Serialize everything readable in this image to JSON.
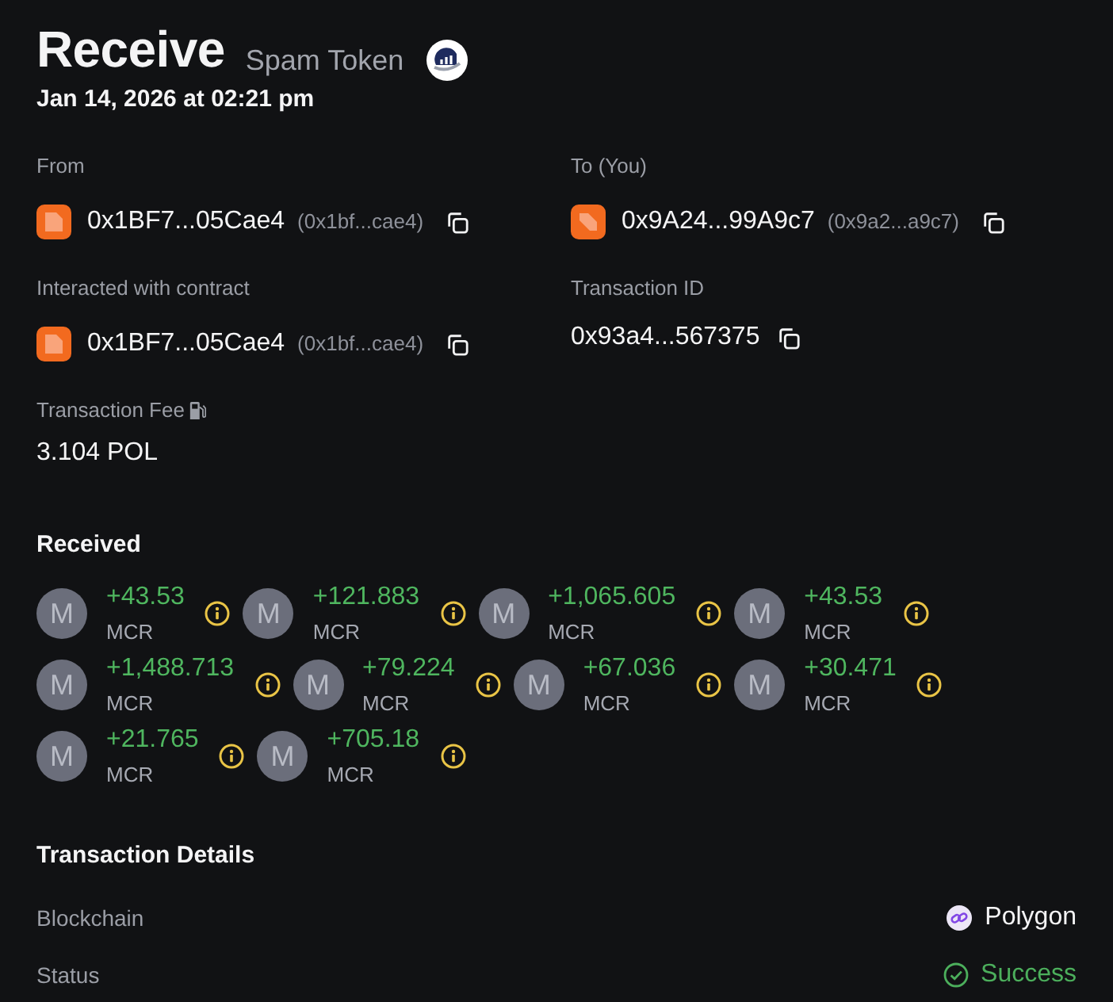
{
  "header": {
    "title": "Receive",
    "subtitle": "Spam Token",
    "date": "Jan 14, 2026 at 02:21 pm"
  },
  "fields": [
    {
      "kind": "address",
      "label": "From",
      "avatar": {
        "kind": "fold"
      },
      "value": "0x1BF7...05Cae4",
      "short": "(0x1bf...cae4)"
    },
    {
      "kind": "address",
      "label": "To (You)",
      "avatar": {
        "kind": "stripe"
      },
      "value": "0x9A24...99A9c7",
      "short": "(0x9a2...a9c7)"
    },
    {
      "kind": "address",
      "label": "Interacted with contract",
      "avatar": {
        "kind": "fold"
      },
      "value": "0x1BF7...05Cae4",
      "short": "(0x1bf...cae4)"
    },
    {
      "kind": "hash",
      "label": "Transaction ID",
      "value": "0x93a4...567375"
    },
    {
      "kind": "fee",
      "label": "Transaction Fee",
      "value": "3.104 POL"
    }
  ],
  "received": {
    "title": "Received",
    "tokens": [
      {
        "letter": "M",
        "amount": "+43.53",
        "symbol": "MCR"
      },
      {
        "letter": "M",
        "amount": "+121.883",
        "symbol": "MCR"
      },
      {
        "letter": "M",
        "amount": "+1,065.605",
        "symbol": "MCR"
      },
      {
        "letter": "M",
        "amount": "+43.53",
        "symbol": "MCR"
      },
      {
        "letter": "M",
        "amount": "+1,488.713",
        "symbol": "MCR"
      },
      {
        "letter": "M",
        "amount": "+79.224",
        "symbol": "MCR"
      },
      {
        "letter": "M",
        "amount": "+67.036",
        "symbol": "MCR"
      },
      {
        "letter": "M",
        "amount": "+30.471",
        "symbol": "MCR"
      },
      {
        "letter": "M",
        "amount": "+21.765",
        "symbol": "MCR"
      },
      {
        "letter": "M",
        "amount": "+705.18",
        "symbol": "MCR"
      }
    ]
  },
  "details": {
    "title": "Transaction Details",
    "rows": [
      {
        "kind": "network",
        "label": "Blockchain",
        "value": "Polygon"
      },
      {
        "kind": "success",
        "label": "Status",
        "value": "Success"
      }
    ]
  }
}
